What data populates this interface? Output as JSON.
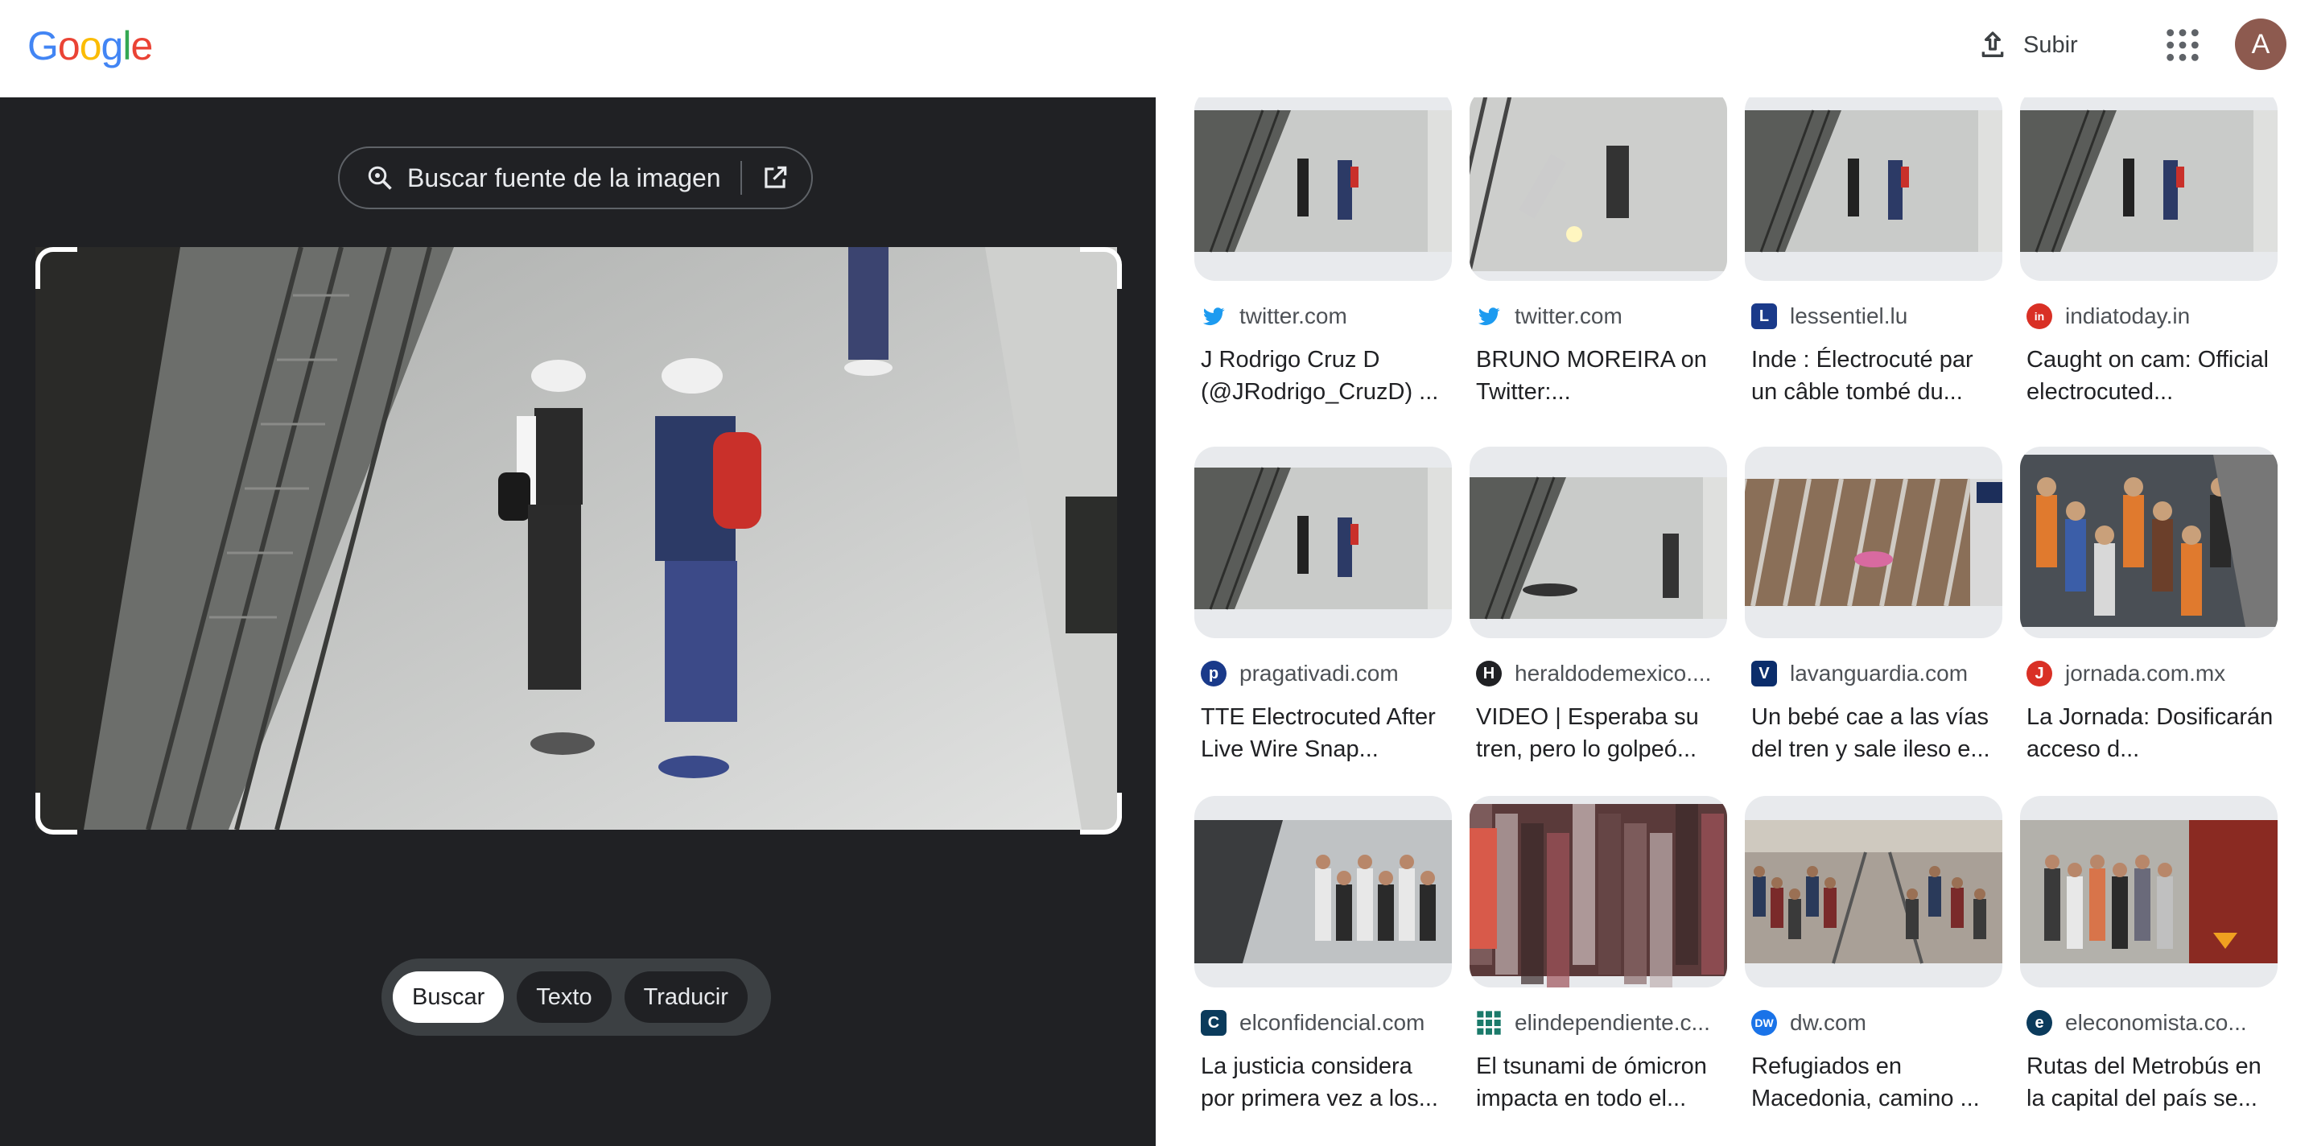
{
  "header": {
    "logo_text": "Google",
    "logo_colors": [
      "#4285F4",
      "#EA4335",
      "#FBBC05",
      "#4285F4",
      "#34A853",
      "#EA4335"
    ],
    "upload_label": "Subir",
    "apps_icon": "apps-grid-icon",
    "avatar_letter": "A"
  },
  "lens": {
    "source_button_label": "Buscar fuente de la imagen",
    "modes": [
      "Buscar",
      "Texto",
      "Traducir"
    ],
    "active_mode": "Buscar"
  },
  "results": [
    {
      "source": "twitter.com",
      "title": "J Rodrigo Cruz D (@JRodrigo_CruzD) ...",
      "fav_color": "#1d9bf0",
      "fav": "bird",
      "scene": "platform"
    },
    {
      "source": "twitter.com",
      "title": "BRUNO MOREIRA on Twitter:...",
      "fav_color": "#1d9bf0",
      "fav": "bird",
      "scene": "spark"
    },
    {
      "source": "lessentiel.lu",
      "title": "Inde : Électrocuté par un câble tombé du...",
      "fav_color": "#1a3a8a",
      "fav": "L",
      "scene": "platform"
    },
    {
      "source": "indiatoday.in",
      "title": "Caught on cam: Official electrocuted...",
      "fav_color": "#d93025",
      "fav": "in",
      "scene": "platform"
    },
    {
      "source": "pragativadi.com",
      "title": "TTE Electrocuted After Live Wire Snap...",
      "fav_color": "#1a3a8a",
      "fav": "p",
      "scene": "platform"
    },
    {
      "source": "heraldodemexico....",
      "title": "VIDEO | Esperaba su tren, pero lo golpeó...",
      "fav_color": "#202124",
      "fav": "H",
      "scene": "fallen"
    },
    {
      "source": "lavanguardia.com",
      "title": "Un bebé cae a las vías del tren y sale ileso e...",
      "fav_color": "#0b2d6b",
      "fav": "V",
      "scene": "tracks"
    },
    {
      "source": "jornada.com.mx",
      "title": "La Jornada: Dosificarán acceso d...",
      "fav_color": "#d93025",
      "fav": "J",
      "scene": "crowd"
    },
    {
      "source": "elconfidencial.com",
      "title": "La justicia considera por primera vez a los...",
      "fav_color": "#0b3b5c",
      "fav": "C",
      "scene": "metro"
    },
    {
      "source": "elindependiente.c...",
      "title": "El tsunami de ómicron impacta en todo el...",
      "fav_color": "#1a7a6a",
      "fav": "grid",
      "scene": "blur"
    },
    {
      "source": "dw.com",
      "title": "Refugiados en Macedonia, camino ...",
      "fav_color": "#1a73e8",
      "fav": "DW",
      "scene": "refugees"
    },
    {
      "source": "eleconomista.co...",
      "title": "Rutas del Metrobús en la capital del país se...",
      "fav_color": "#0b3b5c",
      "fav": "e",
      "scene": "metrobus"
    }
  ]
}
